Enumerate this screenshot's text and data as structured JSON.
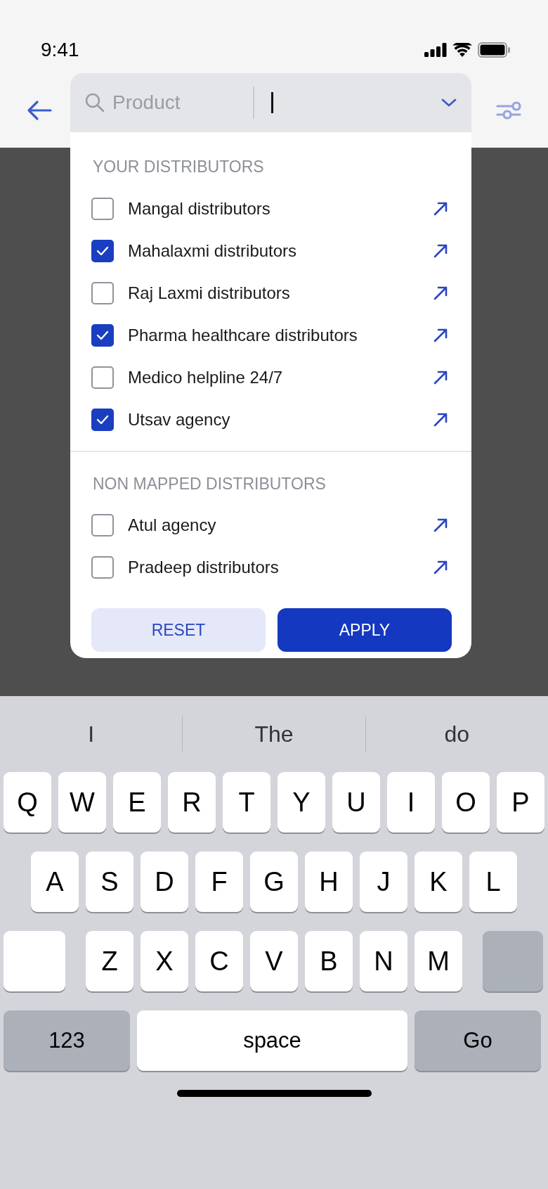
{
  "status_bar": {
    "time": "9:41"
  },
  "search": {
    "placeholder": "Product"
  },
  "sections": [
    {
      "title": "YOUR DISTRIBUTORS",
      "items": [
        {
          "label": "Mangal distributors",
          "checked": false
        },
        {
          "label": "Mahalaxmi distributors",
          "checked": true
        },
        {
          "label": "Raj Laxmi distributors",
          "checked": false
        },
        {
          "label": "Pharma healthcare distributors",
          "checked": true
        },
        {
          "label": "Medico helpline 24/7",
          "checked": false
        },
        {
          "label": "Utsav agency",
          "checked": true
        }
      ]
    },
    {
      "title": "NON MAPPED DISTRIBUTORS",
      "items": [
        {
          "label": "Atul agency",
          "checked": false
        },
        {
          "label": "Pradeep distributors",
          "checked": false
        }
      ]
    }
  ],
  "buttons": [
    {
      "label": "RESET",
      "kind": "secondary"
    },
    {
      "label": "APPLY",
      "kind": "primary"
    }
  ],
  "keyboard": {
    "suggestions": [
      "I",
      "The",
      "do"
    ],
    "rows": [
      [
        {
          "label": "Q",
          "kind": "letter"
        },
        {
          "label": "W",
          "kind": "letter"
        },
        {
          "label": "E",
          "kind": "letter"
        },
        {
          "label": "R",
          "kind": "letter"
        },
        {
          "label": "T",
          "kind": "letter"
        },
        {
          "label": "Y",
          "kind": "letter"
        },
        {
          "label": "U",
          "kind": "letter"
        },
        {
          "label": "I",
          "kind": "letter"
        },
        {
          "label": "O",
          "kind": "letter"
        },
        {
          "label": "P",
          "kind": "letter"
        }
      ],
      [
        {
          "label": "A",
          "kind": "letter"
        },
        {
          "label": "S",
          "kind": "letter"
        },
        {
          "label": "D",
          "kind": "letter"
        },
        {
          "label": "F",
          "kind": "letter"
        },
        {
          "label": "G",
          "kind": "letter"
        },
        {
          "label": "H",
          "kind": "letter"
        },
        {
          "label": "J",
          "kind": "letter"
        },
        {
          "label": "K",
          "kind": "letter"
        },
        {
          "label": "L",
          "kind": "letter"
        }
      ],
      [
        {
          "kind": "shift"
        },
        {
          "label": "Z",
          "kind": "letter"
        },
        {
          "label": "X",
          "kind": "letter"
        },
        {
          "label": "C",
          "kind": "letter"
        },
        {
          "label": "V",
          "kind": "letter"
        },
        {
          "label": "B",
          "kind": "letter"
        },
        {
          "label": "N",
          "kind": "letter"
        },
        {
          "label": "M",
          "kind": "letter"
        },
        {
          "kind": "delete"
        }
      ]
    ],
    "bottom_row": {
      "mode_key": "123",
      "space_key": "space",
      "action_key": "Go"
    }
  }
}
